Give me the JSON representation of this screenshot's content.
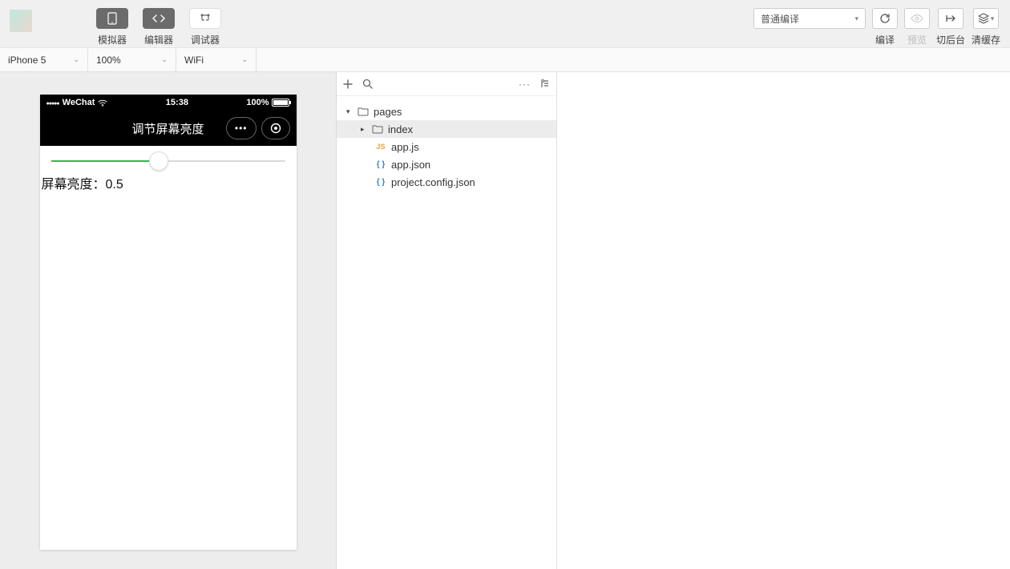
{
  "topbar": {
    "tools": [
      {
        "label": "模拟器",
        "icon": "device-icon",
        "style": "dark"
      },
      {
        "label": "编辑器",
        "icon": "code-icon",
        "style": "dark"
      },
      {
        "label": "调试器",
        "icon": "debug-icon",
        "style": "light"
      }
    ],
    "compile_mode": "普通编译",
    "actions": {
      "compile": "编译",
      "preview": "预览",
      "background": "切后台",
      "clear_cache": "清缓存"
    }
  },
  "secondbar": {
    "device": "iPhone 5",
    "zoom": "100%",
    "network": "WiFi"
  },
  "simulator": {
    "statusbar": {
      "carrier": "WeChat",
      "time": "15:38",
      "battery": "100%"
    },
    "nav_title": "调节屏幕亮度",
    "brightness_label": "屏幕亮度：",
    "brightness_value": "0.5",
    "slider_percent": 46
  },
  "tree": {
    "root": "pages",
    "root_children": [
      {
        "name": "index",
        "type": "folder"
      }
    ],
    "files": [
      {
        "name": "app.js",
        "icon": "js"
      },
      {
        "name": "app.json",
        "icon": "json"
      },
      {
        "name": "project.config.json",
        "icon": "json"
      }
    ]
  }
}
